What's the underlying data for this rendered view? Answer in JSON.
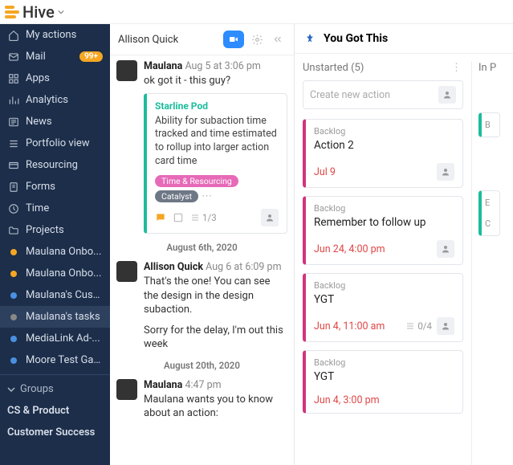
{
  "brand": "Hive",
  "sidebar": {
    "items": [
      {
        "label": "My actions"
      },
      {
        "label": "Mail",
        "badge": "99+"
      },
      {
        "label": "Apps"
      },
      {
        "label": "Analytics"
      },
      {
        "label": "News"
      },
      {
        "label": "Portfolio view"
      },
      {
        "label": "Resourcing"
      },
      {
        "label": "Forms"
      },
      {
        "label": "Time"
      },
      {
        "label": "Projects"
      },
      {
        "label": "Maulana Onbo..."
      },
      {
        "label": "Maulana Onbo..."
      },
      {
        "label": "Maulana's Cust..."
      },
      {
        "label": "Maulana's tasks"
      },
      {
        "label": "MediaLink Ad-..."
      },
      {
        "label": "Moore Test Gantt"
      }
    ],
    "groups_header": "Groups",
    "groups": [
      {
        "label": "CS & Product"
      },
      {
        "label": "Customer Success"
      }
    ]
  },
  "chat": {
    "title": "Allison Quick",
    "messages": [
      {
        "author": "Maulana",
        "time": "Aug 5 at 3:06 pm",
        "text": "ok got it - this guy?",
        "card": {
          "title": "Starline Pod",
          "text": "Ability for subaction time tracked and time estimated to rollup into larger action card time",
          "tags": [
            "Time & Resourcing",
            "Catalyst"
          ],
          "sub": "1/3"
        }
      },
      {
        "sep": "August 6th, 2020"
      },
      {
        "author": "Allison Quick",
        "time": "Aug 6 at 6:09 pm",
        "text": "That's the one! You can see the design in the design subaction.",
        "text2": "Sorry for the delay, I'm out this week"
      },
      {
        "sep": "August 20th, 2020"
      },
      {
        "author": "Maulana",
        "time": "4:47 pm",
        "text": "Maulana wants you to know about an action:"
      }
    ]
  },
  "board": {
    "title": "You Got This",
    "col1": {
      "header": "Unstarted (5)",
      "placeholder": "Create new action"
    },
    "col2": {
      "header": "In P"
    },
    "cards": [
      {
        "label": "Backlog",
        "title": "Action 2",
        "due": "Jul 9"
      },
      {
        "label": "Backlog",
        "title": "Remember to follow up",
        "due": "Jun 24, 4:00 pm"
      },
      {
        "label": "Backlog",
        "title": "YGT",
        "due": "Jun 4, 11:00 am",
        "sub": "0/4"
      },
      {
        "label": "Backlog",
        "title": "YGT",
        "due": "Jun 4, 3:00 pm"
      }
    ],
    "edge": [
      {
        "label": "B"
      },
      {
        "label": "E",
        "sub": "C"
      }
    ]
  }
}
